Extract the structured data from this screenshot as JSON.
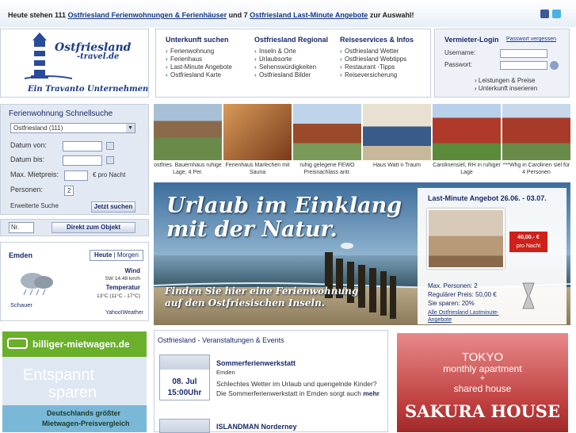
{
  "topbar": {
    "text_a": "Heute stehen 111",
    "link_a": "Ostfriesland Ferienwohnungen & Ferienhäuser",
    "text_b": "und 7",
    "link_b": "Ostfriesland Last-Minute Angebote",
    "text_c": "zur Auswahl!"
  },
  "logo": {
    "brand_line1": "Ostfriesland",
    "brand_line2": "-travel.de",
    "tagline": "Ein Travanto Unternehmen"
  },
  "nav": {
    "columns": [
      {
        "title": "Unterkunft suchen",
        "items": [
          "Ferienwohnung",
          "Ferienhaus",
          "Last-Minute Angebote",
          "Ostfriesland Karte"
        ]
      },
      {
        "title": "Ostfriesland Regional",
        "items": [
          "Inseln & Orte",
          "Urlaubsorte",
          "Sehenswürdigkeiten",
          "Ostfriesland Bilder"
        ]
      },
      {
        "title": "Reiseservices & Infos",
        "items": [
          "Ostfriesland Wetter",
          "Ostfriesland Webtipps",
          "Restaurant -Tipps",
          "Reiseversicherung"
        ]
      }
    ]
  },
  "login": {
    "title": "Vermieter-Login",
    "forgot": "Passwort vergessen",
    "username_label": "Username:",
    "password_label": "Passwort:",
    "links": [
      "Leistungen & Preise",
      "Unterkunft inserieren"
    ]
  },
  "search": {
    "title": "Ferienwohnung Schnellsuche",
    "region_value": "Ostfriesland (111)",
    "date_from_label": "Datum von:",
    "date_to_label": "Datum bis:",
    "max_price_label": "Max. Mietpreis:",
    "price_unit": "€ pro Nacht",
    "persons_label": "Personen:",
    "persons_value": "2",
    "extended_label": "Erweiterte Suche",
    "search_button": "Jetzt suchen",
    "nr_placeholder": "Nr.",
    "direct_button": "Direkt zum Objekt"
  },
  "weather": {
    "city": "Emden",
    "tab_today": "Heute",
    "tab_tomorrow": "Morgen",
    "wind_label": "Wind",
    "wind_value": "SW 14.48 km/h",
    "temp_label": "Temperatur",
    "temp_value": "13°C (11°C - 17°C)",
    "condition": "Schauer",
    "source": "Yahoo!Weather"
  },
  "thumbs": [
    {
      "caption": "ostfries. Bauernhaus ruhige Lage, 4 Per."
    },
    {
      "caption": "Ferienhaus Marlechen mit Sauna"
    },
    {
      "caption": "ruhig gelegene FEWO Preisnachlass antr."
    },
    {
      "caption": "Haus Watt n Traum"
    },
    {
      "caption": "Carolinensiel, RH in ruhiger Lage"
    },
    {
      "caption": "***Whg in Carolinen siel für 4 Personen"
    }
  ],
  "banner": {
    "headline_1": "Urlaub im Einklang",
    "headline_2": "mit der Natur.",
    "sub_1": "Finden Sie hier eine Ferienwohnung",
    "sub_2": "auf den Ostfriesischen Inseln."
  },
  "lastminute": {
    "title": "Last-Minute Angebot 26.06. - 03.07.",
    "price_tag": "40,00.- €",
    "price_unit": "pro Nacht",
    "max_persons": "Max. Personen: 2",
    "regular_price": "Regulärer Preis: 50,00 €",
    "savings": "Sie sparen: 20%",
    "all_link": "Alle Ostfriesland Lastminute-Angebote"
  },
  "leftad": {
    "brand": "billiger-mietwagen.de",
    "line1": "Entspannt",
    "line2": "sparen",
    "line3": "Deutschlands größter",
    "line4": "Mietwagen-Preisvergleich"
  },
  "events": {
    "title": "Ostfriesland - Veranstaltungen & Events",
    "items": [
      {
        "date": "08. Jul",
        "time": "15:00Uhr",
        "name": "Sommerferienwerkstatt",
        "place": "Emden",
        "desc": "Schlechtes Wetter im Urlaub und quengelnde Kinder? Die Sommerferienwerkstatt in Emden sorgt auch",
        "more": "mehr"
      },
      {
        "name": "ISLANDMAN Norderney"
      }
    ]
  },
  "rightad": {
    "line1": "TOKYO",
    "line2": "monthly apartment",
    "plus": "+",
    "line3": "shared house",
    "brand": "SAKURA HOUSE"
  },
  "colors": {
    "brand_blue": "#1a3a8a",
    "panel_blue": "#e3e9f3",
    "price_red": "#d0201a"
  }
}
